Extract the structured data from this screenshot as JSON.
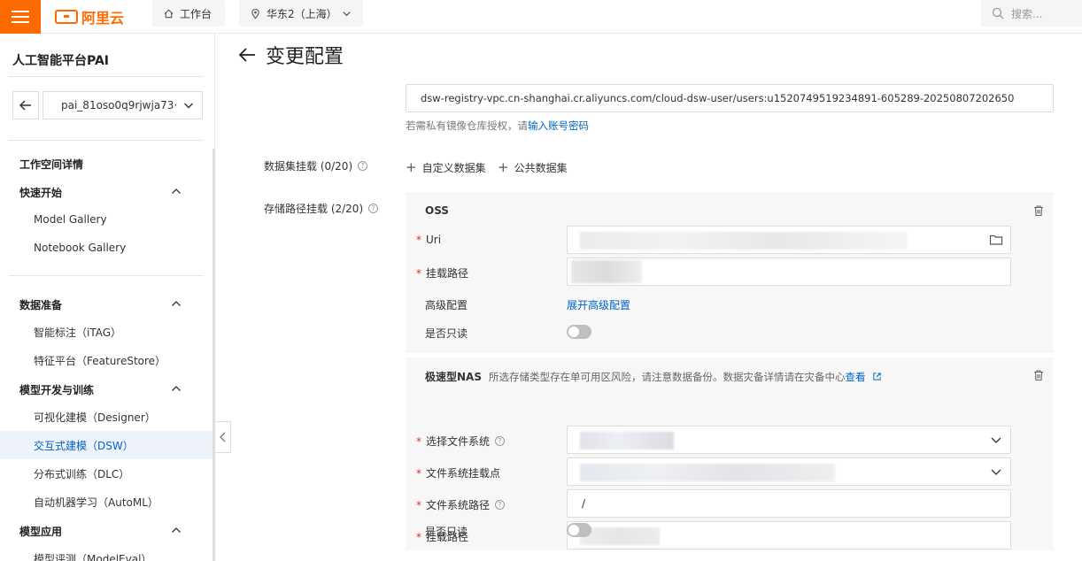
{
  "topbar": {
    "logo_text": "阿里云",
    "workbench_label": "工作台",
    "region_label": "华东2（上海）",
    "search_placeholder": "搜索...",
    "brand_color": "#ff6a00"
  },
  "sidebar": {
    "title": "人工智能平台PAI",
    "workspace_select": "pai_81oso0q9rjwja73·",
    "sections": [
      {
        "label": "工作空间详情"
      },
      {
        "label": "快速开始",
        "items": [
          "Model Gallery",
          "Notebook Gallery"
        ]
      },
      {
        "label": "数据准备",
        "items": [
          "智能标注（iTAG）",
          "特征平台（FeatureStore）"
        ]
      },
      {
        "label": "模型开发与训练",
        "items": [
          "可视化建模（Designer）",
          "交互式建模（DSW）",
          "分布式训练（DLC）",
          "自动机器学习（AutoML）"
        ]
      },
      {
        "label": "模型应用",
        "items": [
          "模型评测（ModelEval）"
        ]
      }
    ],
    "active_item": "交互式建模（DSW）"
  },
  "main": {
    "page_title": "变更配置",
    "image_url": "dsw-registry-vpc.cn-shanghai.cr.aliyuncs.com/cloud-dsw-user/users:u1520749519234891-605289-20250807202650",
    "hint_prefix": "若需私有镜像仓库授权，请",
    "hint_link": "输入账号密码",
    "dataset_mount_label": "数据集挂载 (0/20)",
    "add_custom_dataset": "自定义数据集",
    "add_public_dataset": "公共数据集",
    "storage_mount_label": "存储路径挂载 (2/20)",
    "oss": {
      "title": "OSS",
      "uri_label": "Uri",
      "mount_path_label": "挂载路径",
      "advanced_label": "高级配置",
      "advanced_link": "展开高级配置",
      "readonly_label": "是否只读",
      "readonly": false
    },
    "nas": {
      "title": "极速型NAS",
      "warning_text": "所选存储类型存在单可用区风险，请注意数据备份。数据灾备详情请在灾备中心",
      "warning_link": "查看",
      "fs_label": "选择文件系统",
      "mount_point_label": "文件系统挂载点",
      "fs_path_label": "文件系统路径",
      "fs_path_value": "/",
      "mount_path_label": "挂载路径",
      "readonly_label": "是否只读",
      "readonly": false
    }
  }
}
